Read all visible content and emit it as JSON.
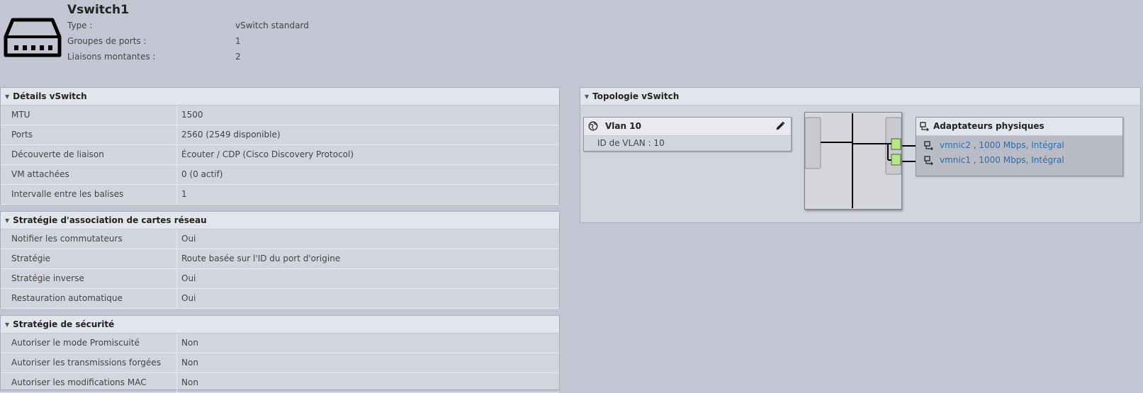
{
  "header": {
    "title": "Vswitch1",
    "rows": [
      {
        "label": "Type :",
        "value": "vSwitch standard"
      },
      {
        "label": "Groupes de ports :",
        "value": "1"
      },
      {
        "label": "Liaisons montantes :",
        "value": "2"
      }
    ]
  },
  "details": {
    "title": "Détails vSwitch",
    "rows": [
      {
        "label": "MTU",
        "value": "1500"
      },
      {
        "label": "Ports",
        "value": "2560 (2549 disponible)"
      },
      {
        "label": "Découverte de liaison",
        "value": "Écouter / CDP (Cisco Discovery Protocol)"
      },
      {
        "label": "VM attachées",
        "value": "0 (0 actif)"
      },
      {
        "label": "Intervalle entre les balises",
        "value": "1"
      }
    ]
  },
  "teaming": {
    "title": "Stratégie d'association de cartes réseau",
    "rows": [
      {
        "label": "Notifier les commutateurs",
        "value": "Oui"
      },
      {
        "label": "Stratégie",
        "value": "Route basée sur l'ID du port d'origine"
      },
      {
        "label": "Stratégie inverse",
        "value": "Oui"
      },
      {
        "label": "Restauration automatique",
        "value": "Oui"
      }
    ]
  },
  "security": {
    "title": "Stratégie de sécurité",
    "rows": [
      {
        "label": "Autoriser le mode Promiscuité",
        "value": "Non"
      },
      {
        "label": "Autoriser les transmissions forgées",
        "value": "Non"
      },
      {
        "label": "Autoriser les modifications MAC",
        "value": "Non"
      }
    ]
  },
  "topology": {
    "title": "Topologie vSwitch",
    "port_group": {
      "name": "Vlan 10",
      "vlan_id": "ID de VLAN : 10"
    },
    "physical": {
      "title": "Adaptateurs physiques",
      "nics": [
        "vmnic2 , 1000 Mbps, Intégral",
        "vmnic1 , 1000 Mbps, Intégral"
      ]
    }
  },
  "colors": {
    "link": "#2d6ca7",
    "port_green": "#b6e58c"
  }
}
